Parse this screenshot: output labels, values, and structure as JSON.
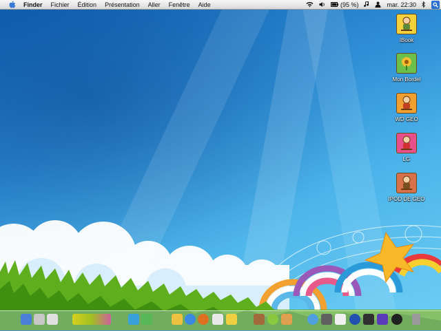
{
  "menubar": {
    "items": [
      "Finder",
      "Fichier",
      "Édition",
      "Présentation",
      "Aller",
      "Fenêtre",
      "Aide"
    ],
    "battery": "(95 %)",
    "clock": "mar. 22:30"
  },
  "desktop_icons": [
    {
      "label": "IBook"
    },
    {
      "label": "Mon Bordel"
    },
    {
      "label": "WD GEO"
    },
    {
      "label": "LG"
    },
    {
      "label": "IPOD DE GEO"
    }
  ],
  "colors": {
    "accent": "#2b6fd1",
    "icon_bg": "#f4c430"
  },
  "dock": {
    "icons": [
      "finder-icon",
      "mac-icon",
      "disk-icon",
      "wup-icon",
      "bird-icon",
      "mail-icon",
      "safari-icon",
      "firefox-icon",
      "photo-booth-icon",
      "adium-icon",
      "tool-icon",
      "clock-icon",
      "itunes-icon",
      "iphoto-icon",
      "ical-icon",
      "network-icon",
      "movie-icon",
      "dashboard-icon",
      "trash-icon"
    ]
  }
}
